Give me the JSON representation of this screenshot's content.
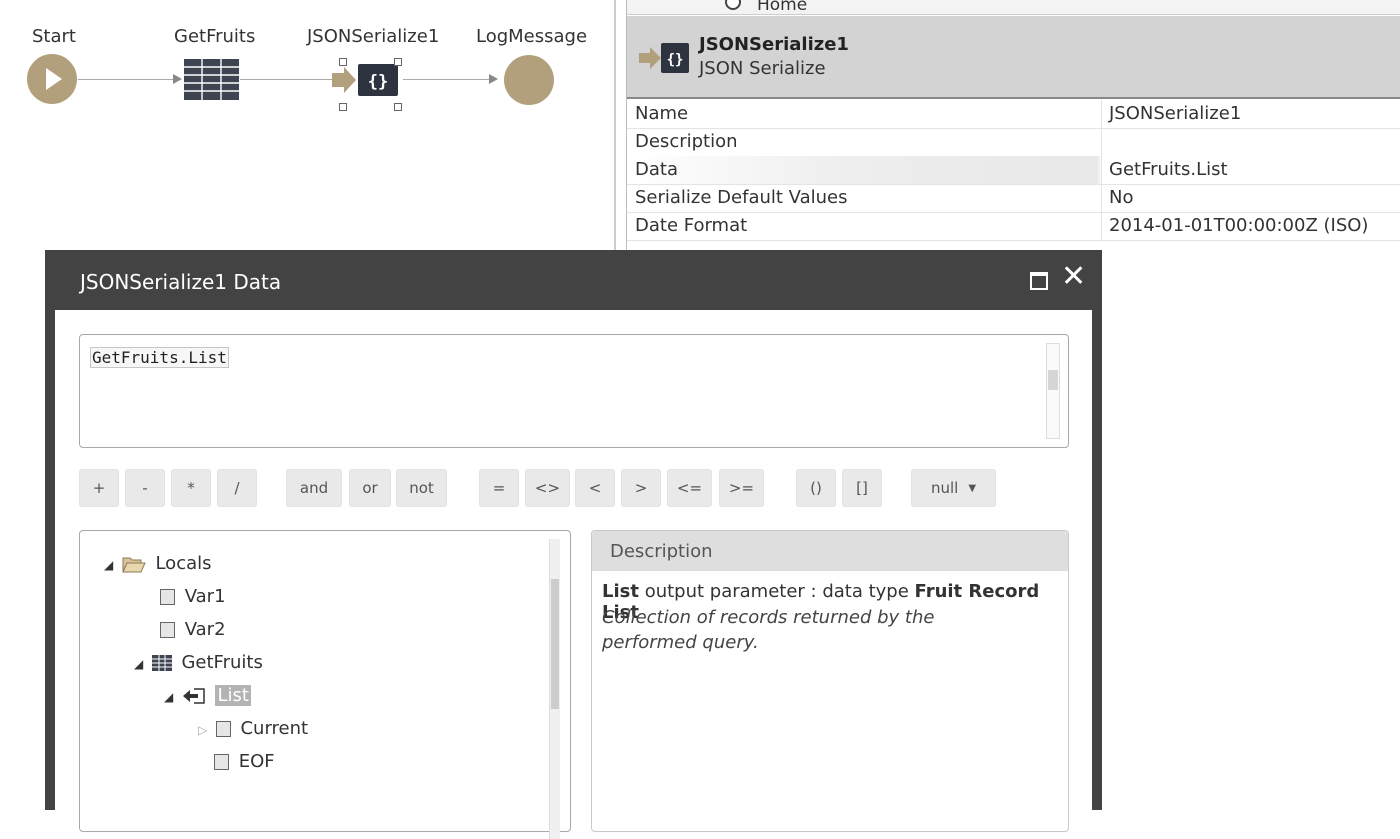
{
  "flow": {
    "nodes": [
      {
        "label": "Start",
        "type": "start"
      },
      {
        "label": "GetFruits",
        "type": "aggregate"
      },
      {
        "label": "JSONSerialize1",
        "type": "json-serialize"
      },
      {
        "label": "LogMessage",
        "type": "log"
      }
    ]
  },
  "properties": {
    "breadcrumb": "Home",
    "header_title": "JSONSerialize1",
    "header_subtitle": "JSON Serialize",
    "rows": [
      {
        "name": "Name",
        "value": "JSONSerialize1"
      },
      {
        "name": "Description",
        "value": ""
      },
      {
        "name": "Data",
        "value": "GetFruits.List"
      },
      {
        "name": "Serialize Default Values",
        "value": "No"
      },
      {
        "name": "Date Format",
        "value": "2014-01-01T00:00:00Z (ISO)"
      }
    ]
  },
  "dialog": {
    "title": "JSONSerialize1 Data",
    "expression": "GetFruits.List",
    "operators": [
      "+",
      "-",
      "*",
      "/",
      "and",
      "or",
      "not",
      "=",
      "<>",
      "<",
      ">",
      "<=",
      ">=",
      "()",
      "[]"
    ],
    "null_dropdown": "null",
    "tree": {
      "locals": "Locals",
      "var1": "Var1",
      "var2": "Var2",
      "getfruits": "GetFruits",
      "list": "List",
      "current": "Current",
      "eof": "EOF"
    },
    "description": {
      "header": "Description",
      "param_name": "List",
      "param_text": "output parameter : data type",
      "param_type": "Fruit Record List",
      "detail": "Collection of records returned by the performed query."
    }
  }
}
